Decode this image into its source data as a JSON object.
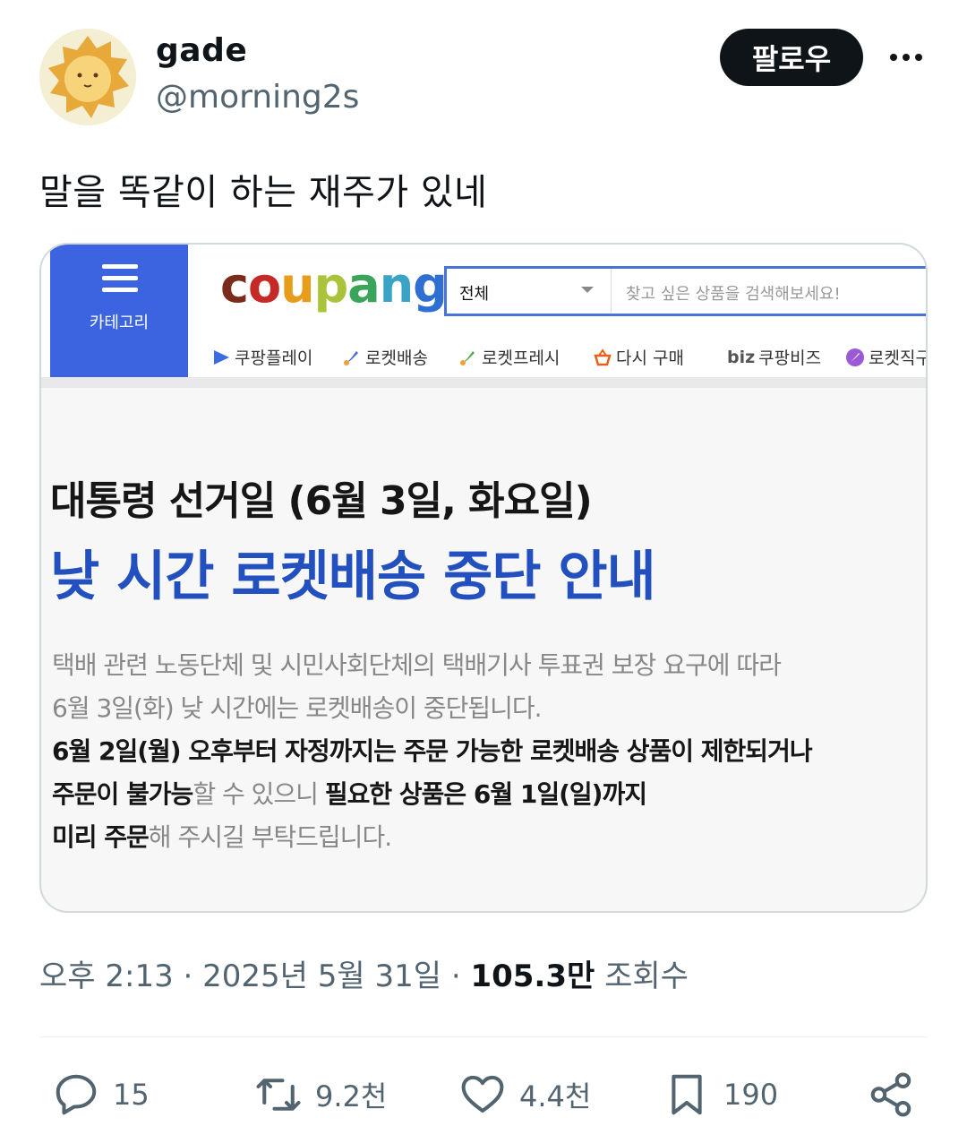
{
  "author": {
    "display_name": "gade",
    "handle": "@morning2s",
    "follow_label": "팔로우"
  },
  "tweet": {
    "text": "말을 똑같이 하는 재주가 있네"
  },
  "image": {
    "category_label": "카테고리",
    "logo": "coupang",
    "search_scope": "전체",
    "search_placeholder": "찾고 싶은 상품을 검색해보세요!",
    "nav": [
      "쿠팡플레이",
      "로켓배송",
      "로켓프레시",
      "다시 구매",
      "biz",
      "쿠팡비즈",
      "로켓직구"
    ],
    "headline": "대통령 선거일 (6월 3일, 화요일)",
    "subheadline": "낮 시간 로켓배송 중단 안내",
    "lines": [
      "택배 관련 노동단체 및 시민사회단체의 택배기사 투표권 보장 요구에 따라",
      "6월 3일(화) 낮 시간에는 로켓배송이 중단됩니다.",
      "6월 2일(월) 오후부터 자정까지는 주문 가능한 로켓배송 상품이 제한되거나",
      "주문이 불가능",
      "할 수 있으니 ",
      "필요한 상품은 6월 1일(일)까지",
      "미리 주문",
      "해 주시길 부탁드립니다."
    ]
  },
  "meta": {
    "time": "오후 2:13 · 2025년 5월 31일 · ",
    "views": "105.3만",
    "views_label": " 조회수"
  },
  "actions": {
    "replies": "15",
    "reposts": "9.2천",
    "likes": "4.4천",
    "bookmarks": "190"
  },
  "colors": {
    "coupang_blue": "#3d64e0",
    "headline_blue": "#2350bf",
    "secondary_text": "#536471"
  }
}
